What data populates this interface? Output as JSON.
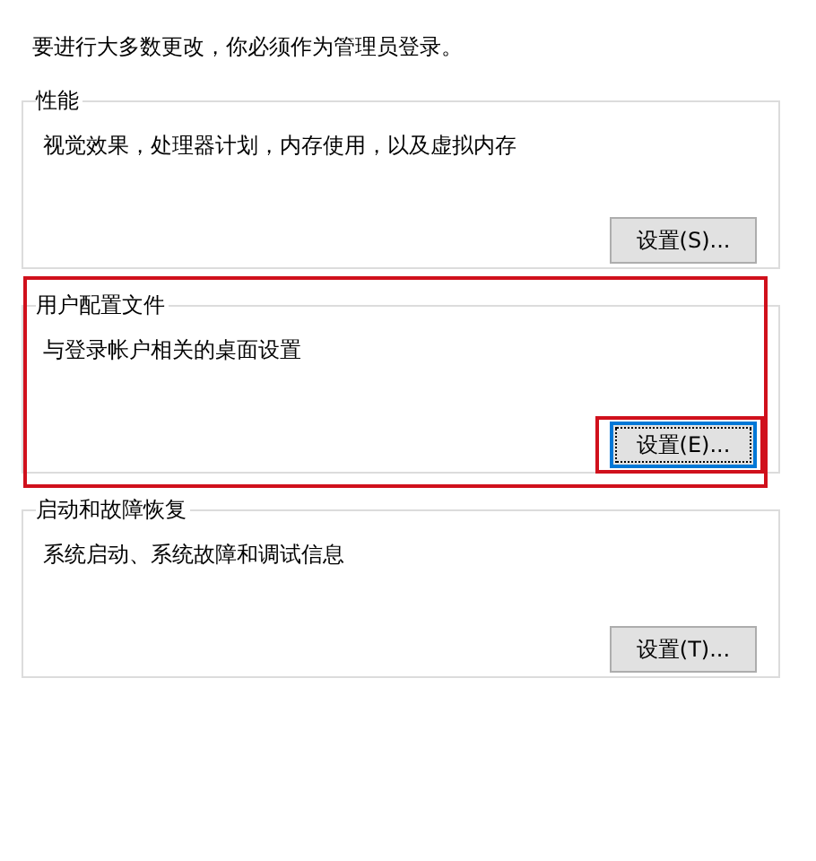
{
  "intro": "要进行大多数更改，你必须作为管理员登录。",
  "groups": [
    {
      "title": "性能",
      "description": "视觉效果，处理器计划，内存使用，以及虚拟内存",
      "highlighted": false,
      "button": {
        "label": "设置(S)...",
        "focused": false,
        "highlighted": false
      }
    },
    {
      "title": "用户配置文件",
      "description": "与登录帐户相关的桌面设置",
      "highlighted": true,
      "button": {
        "label": "设置(E)...",
        "focused": true,
        "highlighted": true
      }
    },
    {
      "title": "启动和故障恢复",
      "description": "系统启动、系统故障和调试信息",
      "highlighted": false,
      "button": {
        "label": "设置(T)...",
        "focused": false,
        "highlighted": false
      }
    }
  ]
}
